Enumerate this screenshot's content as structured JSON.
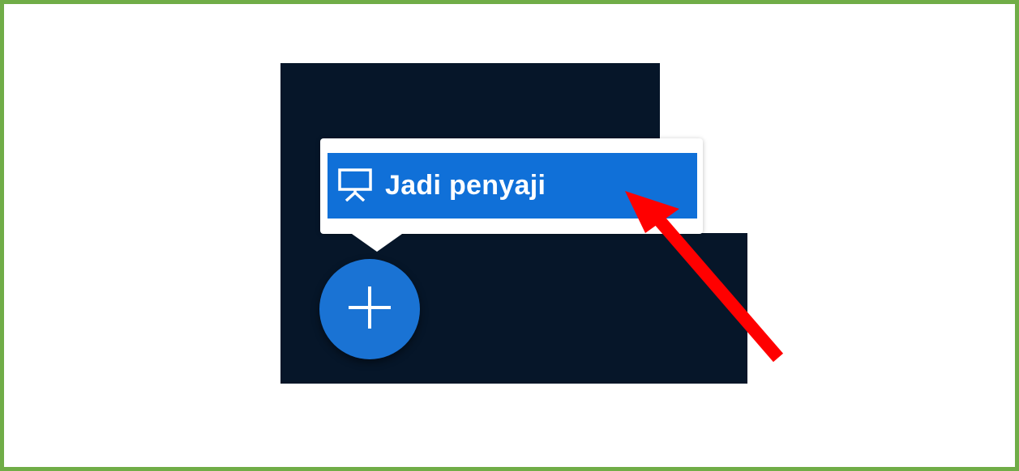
{
  "menu": {
    "present_item": {
      "label": "Jadi penyaji",
      "icon": "presentation-screen-icon"
    }
  },
  "fab": {
    "icon": "plus-icon"
  },
  "annotation": {
    "icon": "red-arrow-icon"
  },
  "colors": {
    "frame_border": "#70ad47",
    "background": "#ffffff",
    "panel": "#061629",
    "menu_highlight": "#1070d8",
    "fab": "#1a73d4",
    "arrow": "#ff0000"
  }
}
